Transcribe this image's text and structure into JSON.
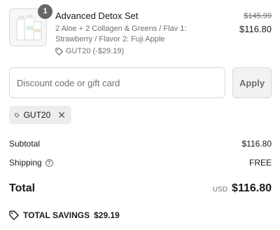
{
  "product": {
    "quantity": "1",
    "name": "Advanced Detox Set",
    "variant": "2 Aloe + 2 Collagen & Greens / Flav 1: Strawberry / Flavor 2: Fuji Apple",
    "discount_line": "GUT20 (-$29.19)",
    "original_price": "$145.99",
    "price": "$116.80",
    "thumbnail_icon": "product-bottles-icon"
  },
  "discount": {
    "placeholder": "Discount code or gift card",
    "value": "",
    "apply_label": "Apply",
    "applied_code": "GUT20",
    "remove_icon": "close-icon"
  },
  "summary": {
    "subtotal_label": "Subtotal",
    "subtotal_value": "$116.80",
    "shipping_label": "Shipping",
    "shipping_value": "FREE",
    "total_label": "Total",
    "currency": "USD",
    "total_value": "$116.80",
    "savings_label": "TOTAL SAVINGS",
    "savings_value": "$29.19"
  },
  "colors": {
    "text": "#1a1a1a",
    "muted": "#707070",
    "border": "#d9d9d9",
    "badge": "#666666",
    "chip": "#ededed"
  }
}
